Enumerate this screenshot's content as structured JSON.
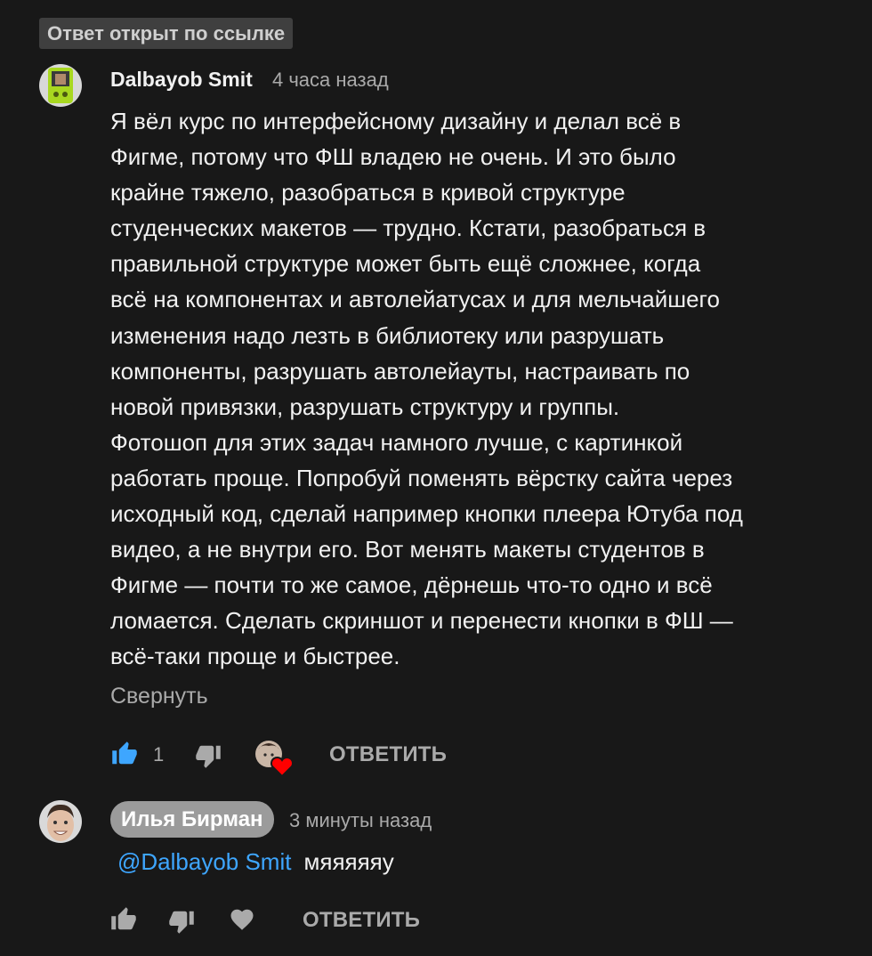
{
  "badge": {
    "label": "Ответ открыт по ссылке"
  },
  "comment": {
    "author": "Dalbayob Smit",
    "time": "4 часа назад",
    "text": "Я вёл курс по интерфейсному дизайну и делал всё в\nФигме, потому что ФШ владею не очень. И это было\nкрайне тяжело, разобраться в кривой структуре\nстуденческих макетов — трудно. Кстати, разобраться в\nправильной структуре может быть ещё сложнее, когда\nвсё на компонентах и автолейатусах и для мельчайшего\nизменения надо лезть в библиотеку или разрушать\nкомпоненты, разрушать автолейауты, настраивать по\nновой привязки, разрушать структуру и группы.\nФотошоп для этих задач намного лучше, с картинкой\nработать проще. Попробуй поменять вёрстку сайта через\nисходный код, сделай например кнопки плеера Ютуба под\nвидео, а не внутри его. Вот менять макеты студентов в\nФигме — почти то же самое, дёрнешь что-то одно и всё\nломается. Сделать скриншот и перенести кнопки в ФШ —\nвсё-таки проще и быстрее.",
    "collapse_label": "Свернуть",
    "like_count": "1",
    "reply_label": "ОТВЕТИТЬ",
    "icons": {
      "like": "thumbs-up-filled-icon",
      "dislike": "thumbs-down-icon",
      "creator_heart": "creator-heart-icon"
    },
    "colors": {
      "like_active": "#3ea6ff",
      "heart": "#ff0000"
    }
  },
  "reply": {
    "author": "Илья Бирман",
    "time": "3 минуты назад",
    "mention": "@Dalbayob Smit",
    "text": "мяяяяяу",
    "reply_label": "ОТВЕТИТЬ",
    "icons": {
      "like": "thumbs-up-icon",
      "dislike": "thumbs-down-icon",
      "heart": "heart-icon"
    }
  }
}
